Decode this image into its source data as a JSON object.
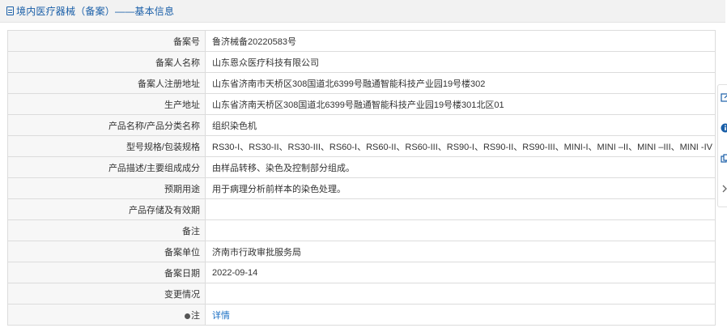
{
  "header": {
    "title": "境内医疗器械（备案）——基本信息"
  },
  "rows": [
    {
      "label": "备案号",
      "value": "鲁济械备20220583号"
    },
    {
      "label": "备案人名称",
      "value": "山东恩众医疗科技有限公司"
    },
    {
      "label": "备案人注册地址",
      "value": "山东省济南市天桥区308国道北6399号融通智能科技产业园19号楼302"
    },
    {
      "label": "生产地址",
      "value": "山东省济南天桥区308国道北6399号融通智能科技产业园19号楼301北区01"
    },
    {
      "label": "产品名称/产品分类名称",
      "value": "组织染色机"
    },
    {
      "label": "型号规格/包装规格",
      "value": "RS30-I、RS30-II、RS30-III、RS60-I、RS60-II、RS60-III、RS90-I、RS90-II、RS90-III、MINI-I、MINI –II、MINI –III、MINI -IV"
    },
    {
      "label": "产品描述/主要组成成分",
      "value": "由样品转移、染色及控制部分组成。"
    },
    {
      "label": "预期用途",
      "value": "用于病理分析前样本的染色处理。"
    },
    {
      "label": "产品存储及有效期",
      "value": ""
    },
    {
      "label": "备注",
      "value": ""
    },
    {
      "label": "备案单位",
      "value": "济南市行政审批服务局"
    },
    {
      "label": "备案日期",
      "value": "2022-09-14"
    },
    {
      "label": "变更情况",
      "value": ""
    }
  ],
  "note_row": {
    "label": "注",
    "link_text": "详情",
    "icon": "pin-icon"
  },
  "side_toolbar": {
    "icons": [
      "edit-icon",
      "info-icon",
      "copy-icon",
      "collapse-arrow-icon"
    ]
  },
  "colors": {
    "accent": "#1a5fa8",
    "link": "#1a6fc4",
    "label_bg": "#f7f7f7",
    "border": "#dcdcdc",
    "header_bg": "#f2f2f2"
  }
}
